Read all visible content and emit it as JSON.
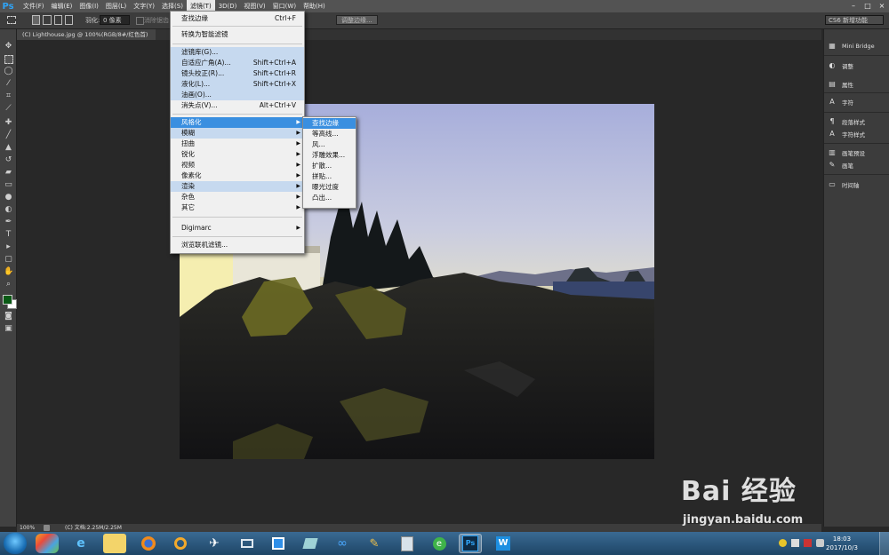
{
  "app": {
    "logo": "Ps",
    "menus": [
      "文件(F)",
      "编辑(E)",
      "图像(I)",
      "图层(L)",
      "文字(Y)",
      "选择(S)",
      "滤镜(T)",
      "3D(D)",
      "视图(V)",
      "窗口(W)",
      "帮助(H)"
    ],
    "active_menu": "滤镜(T)",
    "window_controls": [
      "–",
      "□",
      "×"
    ]
  },
  "options_bar": {
    "feather_label": "羽化:",
    "feather_value": "0 像素",
    "antialias_label": "消除锯齿",
    "refine_edge_button": "调整边缘...",
    "workspace": "CS6 新增功能"
  },
  "document": {
    "tab_title": "(C) Lighthouse.jpg @ 100%(RGB/8#/红色首)",
    "zoom": "100%",
    "doc_info": "(C) 文档:2.25M/2.25M"
  },
  "filter_menu": {
    "items": [
      {
        "label": "查找边缘",
        "shortcut": "Ctrl+F"
      },
      {
        "label": "转换为智能滤镜",
        "shortcut": ""
      },
      {
        "label": "滤镜库(G)...",
        "shortcut": ""
      },
      {
        "label": "自适应广角(A)...",
        "shortcut": "Shift+Ctrl+A"
      },
      {
        "label": "镜头校正(R)...",
        "shortcut": "Shift+Ctrl+R"
      },
      {
        "label": "液化(L)...",
        "shortcut": "Shift+Ctrl+X"
      },
      {
        "label": "油画(O)...",
        "shortcut": ""
      },
      {
        "label": "消失点(V)...",
        "shortcut": "Alt+Ctrl+V"
      },
      {
        "label": "风格化",
        "shortcut": ""
      },
      {
        "label": "模糊",
        "shortcut": ""
      },
      {
        "label": "扭曲",
        "shortcut": ""
      },
      {
        "label": "锐化",
        "shortcut": ""
      },
      {
        "label": "视频",
        "shortcut": ""
      },
      {
        "label": "像素化",
        "shortcut": ""
      },
      {
        "label": "渲染",
        "shortcut": ""
      },
      {
        "label": "杂色",
        "shortcut": ""
      },
      {
        "label": "其它",
        "shortcut": ""
      },
      {
        "label": "Digimarc",
        "shortcut": ""
      },
      {
        "label": "浏览联机滤镜...",
        "shortcut": ""
      }
    ],
    "submenu_arrow": "▶"
  },
  "stylize_submenu": {
    "items": [
      "查找边缘",
      "等高线...",
      "风...",
      "浮雕效果...",
      "扩散...",
      "拼贴...",
      "曝光过度",
      "凸出..."
    ]
  },
  "right_panel": {
    "items": [
      {
        "label": "Mini Bridge",
        "icon": "mini-bridge-icon"
      },
      {
        "label": "调整",
        "icon": "adjustments-icon"
      },
      {
        "label": "属性",
        "icon": "properties-icon"
      },
      {
        "label": "字符",
        "icon": "character-icon"
      },
      {
        "label": "段落样式",
        "icon": "paragraph-styles-icon"
      },
      {
        "label": "字符样式",
        "icon": "character-styles-icon"
      },
      {
        "label": "画笔预设",
        "icon": "brush-presets-icon"
      },
      {
        "label": "画笔",
        "icon": "brush-icon"
      },
      {
        "label": "时间轴",
        "icon": "timeline-icon"
      }
    ]
  },
  "taskbar": {
    "clock_time": "18:03",
    "clock_date": "2017/10/3"
  },
  "watermark": {
    "text": "Bai 经验",
    "url": "jingyan.baidu.com"
  },
  "colors": {
    "menu_highlight": "#3a8fe0",
    "menu_group_highlight": "#c6d9ef",
    "ps_blue": "#2fa3f5"
  }
}
